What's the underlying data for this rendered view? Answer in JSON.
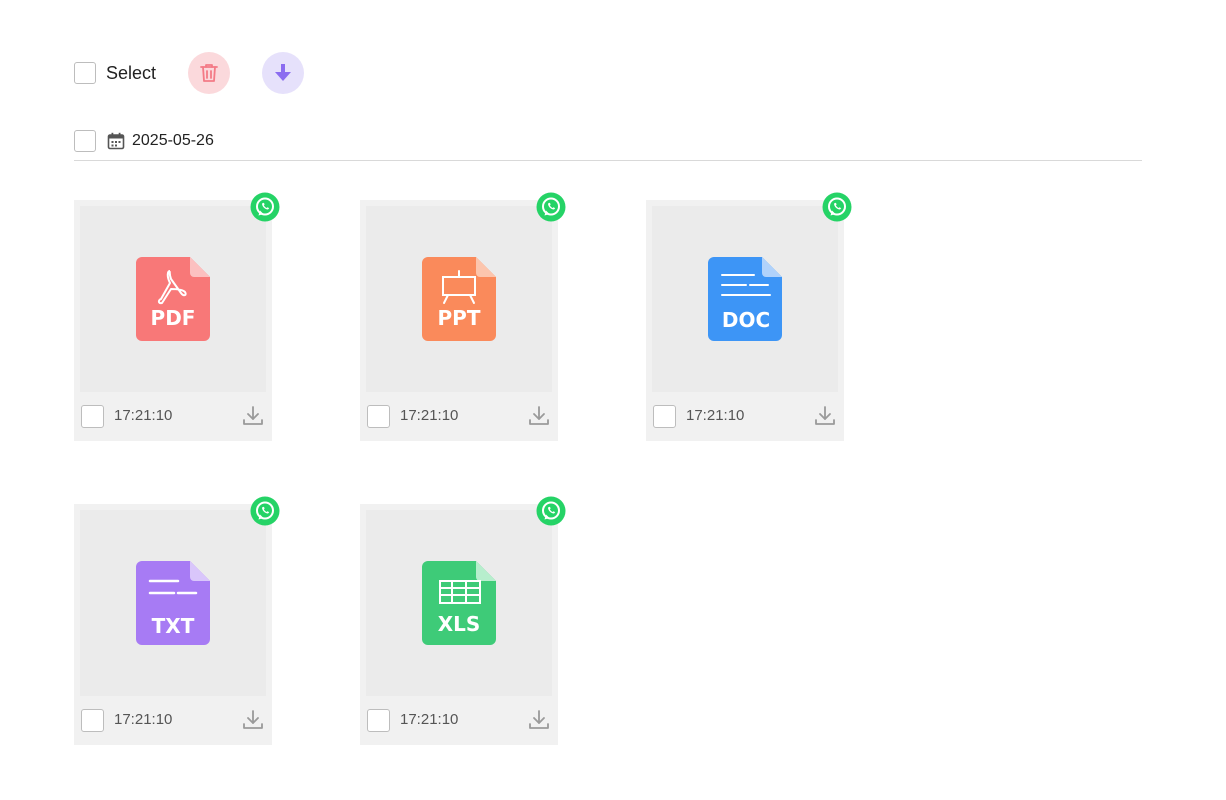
{
  "toolbar": {
    "select_label": "Select"
  },
  "group": {
    "date": "2025-05-26"
  },
  "colors": {
    "pdf": "#f87878",
    "ppt": "#fa8a5b",
    "doc": "#3d95f6",
    "txt": "#a77bf4",
    "xls": "#3ecb78",
    "whatsapp": "#25d366"
  },
  "files": [
    {
      "type_label": "PDF",
      "time": "17:21:10",
      "icon": "pdf-file-icon"
    },
    {
      "type_label": "PPT",
      "time": "17:21:10",
      "icon": "ppt-file-icon"
    },
    {
      "type_label": "DOC",
      "time": "17:21:10",
      "icon": "doc-file-icon"
    },
    {
      "type_label": "TXT",
      "time": "17:21:10",
      "icon": "txt-file-icon"
    },
    {
      "type_label": "XLS",
      "time": "17:21:10",
      "icon": "xls-file-icon"
    }
  ]
}
